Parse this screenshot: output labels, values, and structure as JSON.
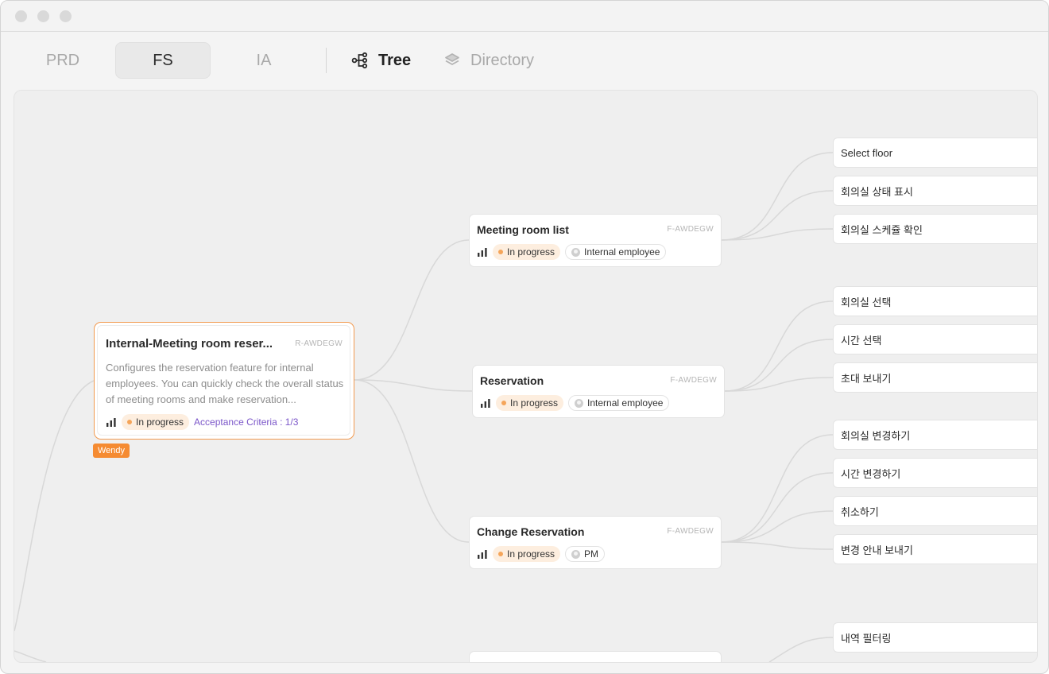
{
  "window": {
    "controls": [
      "close",
      "minimize",
      "maximize"
    ]
  },
  "tabs": [
    {
      "label": "PRD",
      "active": false
    },
    {
      "label": "FS",
      "active": true
    },
    {
      "label": "IA",
      "active": false
    }
  ],
  "views": [
    {
      "label": "Tree",
      "icon": "tree-icon",
      "active": true
    },
    {
      "label": "Directory",
      "icon": "layers-icon",
      "active": false
    }
  ],
  "root": {
    "title": "Internal-Meeting room reser...",
    "code": "R-AWDEGW",
    "description": "Configures the reservation feature for internal employees. You can quickly check the overall status of meeting rooms and make reservation...",
    "status": "In progress",
    "criteria": "Acceptance Criteria : 1/3",
    "assignee": "Wendy"
  },
  "features": [
    {
      "title": "Meeting room list",
      "code": "F-AWDEGW",
      "status": "In progress",
      "owner": "Internal employee"
    },
    {
      "title": "Reservation",
      "code": "F-AWDEGW",
      "status": "In progress",
      "owner": "Internal employee"
    },
    {
      "title": "Change Reservation",
      "code": "F-AWDEGW",
      "status": "In progress",
      "owner": "PM"
    }
  ],
  "leaves": [
    {
      "label": "Select floor"
    },
    {
      "label": "회의실 상태 표시"
    },
    {
      "label": "회의실 스케쥴 확인"
    },
    {
      "label": "회의실 선택"
    },
    {
      "label": "시간 선택"
    },
    {
      "label": "초대 보내기"
    },
    {
      "label": "회의실 변경하기"
    },
    {
      "label": "시간 변경하기"
    },
    {
      "label": "취소하기"
    },
    {
      "label": "변경 안내 보내기"
    },
    {
      "label": "내역 필터링"
    }
  ],
  "colors": {
    "accent": "#f58b32",
    "status_bg": "#fdeedf",
    "status_dot": "#f5a55a",
    "criteria": "#7b56c9",
    "link": "#d6d6d6"
  }
}
